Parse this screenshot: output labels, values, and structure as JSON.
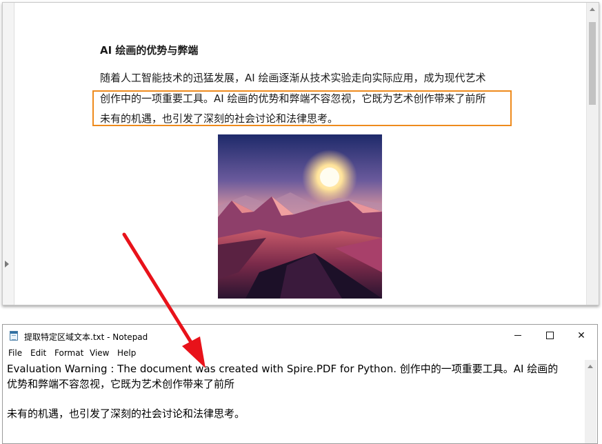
{
  "pdf_viewer": {
    "heading": "AI 绘画的优势与弊端",
    "paragraph_lines": [
      "随着人工智能技术的迅猛发展，AI 绘画逐渐从技术实验走向实际应用，成为现代艺术",
      "创作中的一项重要工具。AI 绘画的优势和弊端不容忽视，它既为艺术创作带来了前所",
      "未有的机遇，也引发了深刻的社会讨论和法律思考。"
    ],
    "selection_color": "#ee8a1c",
    "image_subject": "sunset over mountains"
  },
  "notepad": {
    "title": "提取特定区域文本.txt - Notepad",
    "menu": [
      "File",
      "Edit",
      "Format",
      "View",
      "Help"
    ],
    "lines": [
      "Evaluation Warning : The document was created with Spire.PDF for Python.  创作中的一项重要工具。AI 绘画的",
      "优势和弊端不容忽视，它既为艺术创作带来了前所",
      " 未有的机遇，也引发了深刻的社会讨论和法律思考。"
    ],
    "controls": {
      "close": "✕"
    }
  },
  "annotation": {
    "arrow_color": "#e8121a"
  }
}
